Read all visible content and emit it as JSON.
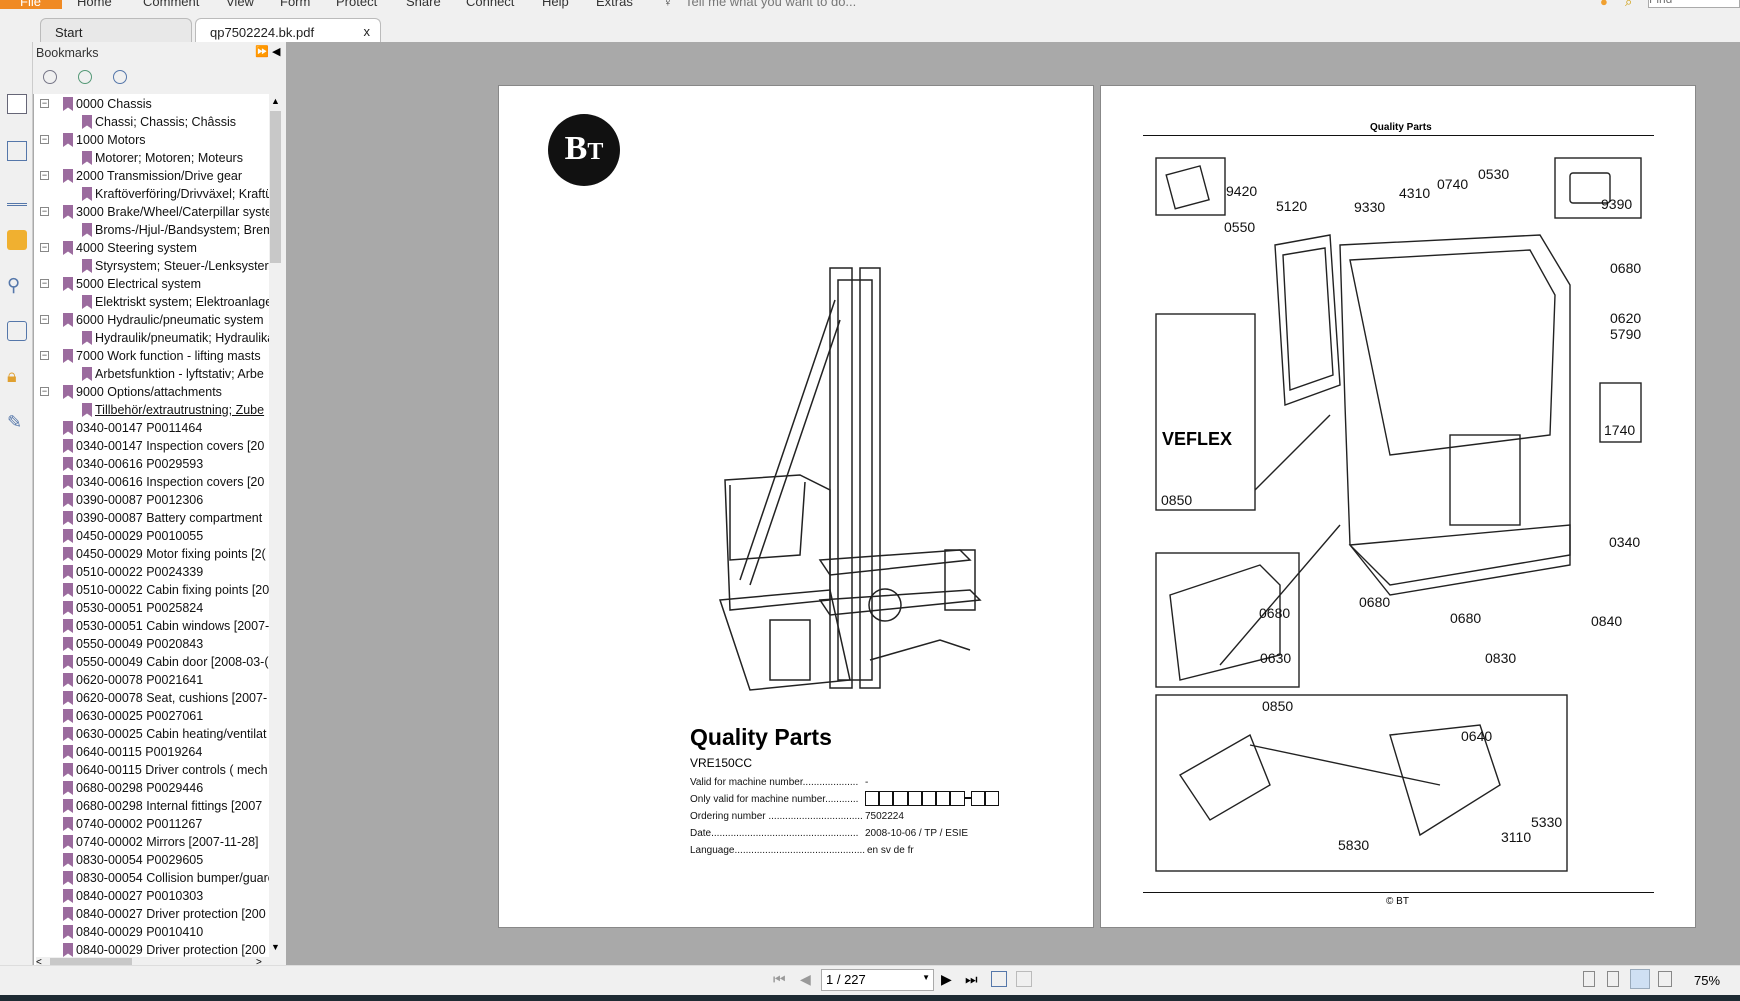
{
  "menu": {
    "file": "File",
    "items": [
      "Home",
      "Comment",
      "View",
      "Form",
      "Protect",
      "Share",
      "Connect",
      "Help",
      "Extras"
    ],
    "tell_me": "Tell me what you want to do...",
    "find_placeholder": "Find"
  },
  "tabs": [
    {
      "label": "Start"
    },
    {
      "label": "qp7502224.bk.pdf",
      "close": "x",
      "active": true
    }
  ],
  "bookmarks": {
    "title": "Bookmarks",
    "items": [
      {
        "level": 0,
        "expand": true,
        "label": "0000 Chassis"
      },
      {
        "level": 1,
        "label": "Chassi; Chassis; Châssis"
      },
      {
        "level": 0,
        "expand": true,
        "label": "1000 Motors"
      },
      {
        "level": 1,
        "label": "Motorer; Motoren; Moteurs"
      },
      {
        "level": 0,
        "expand": true,
        "label": "2000 Transmission/Drive gear"
      },
      {
        "level": 1,
        "label": "Kraftöverföring/Drivväxel; Kraftü"
      },
      {
        "level": 0,
        "expand": true,
        "label": "3000 Brake/Wheel/Caterpillar syste"
      },
      {
        "level": 1,
        "label": "Broms-/Hjul-/Bandsystem; Brem"
      },
      {
        "level": 0,
        "expand": true,
        "label": "4000 Steering system"
      },
      {
        "level": 1,
        "label": "Styrsystem; Steuer-/Lenksyster"
      },
      {
        "level": 0,
        "expand": true,
        "label": "5000 Electrical system"
      },
      {
        "level": 1,
        "label": "Elektriskt system; Elektroanlage"
      },
      {
        "level": 0,
        "expand": true,
        "label": "6000 Hydraulic/pneumatic system"
      },
      {
        "level": 1,
        "label": "Hydraulik/pneumatik; Hydraulika"
      },
      {
        "level": 0,
        "expand": true,
        "label": "7000 Work function - lifting masts"
      },
      {
        "level": 1,
        "label": "Arbetsfunktion - lyftstativ; Arbe"
      },
      {
        "level": 0,
        "expand": true,
        "label": "9000 Options/attachments"
      },
      {
        "level": 1,
        "label": "Tillbehör/extrautrustning; Zube",
        "selected": true
      },
      {
        "level": 0,
        "label": "0340-00147 P0011464"
      },
      {
        "level": 0,
        "label": "0340-00147 Inspection covers [20"
      },
      {
        "level": 0,
        "label": "0340-00616 P0029593"
      },
      {
        "level": 0,
        "label": "0340-00616 Inspection covers [20"
      },
      {
        "level": 0,
        "label": "0390-00087 P0012306"
      },
      {
        "level": 0,
        "label": "0390-00087 Battery compartment"
      },
      {
        "level": 0,
        "label": "0450-00029 P0010055"
      },
      {
        "level": 0,
        "label": "0450-00029 Motor fixing points [2("
      },
      {
        "level": 0,
        "label": "0510-00022 P0024339"
      },
      {
        "level": 0,
        "label": "0510-00022 Cabin fixing points [20"
      },
      {
        "level": 0,
        "label": "0530-00051 P0025824"
      },
      {
        "level": 0,
        "label": "0530-00051 Cabin windows [2007-"
      },
      {
        "level": 0,
        "label": "0550-00049 P0020843"
      },
      {
        "level": 0,
        "label": "0550-00049 Cabin door [2008-03-("
      },
      {
        "level": 0,
        "label": "0620-00078 P0021641"
      },
      {
        "level": 0,
        "label": "0620-00078 Seat, cushions [2007-"
      },
      {
        "level": 0,
        "label": "0630-00025 P0027061"
      },
      {
        "level": 0,
        "label": "0630-00025 Cabin heating/ventilat"
      },
      {
        "level": 0,
        "label": "0640-00115 P0019264"
      },
      {
        "level": 0,
        "label": "0640-00115 Driver controls ( mech"
      },
      {
        "level": 0,
        "label": "0680-00298 P0029446"
      },
      {
        "level": 0,
        "label": "0680-00298 Internal fittings [2007"
      },
      {
        "level": 0,
        "label": "0740-00002 P0011267"
      },
      {
        "level": 0,
        "label": "0740-00002 Mirrors [2007-11-28]"
      },
      {
        "level": 0,
        "label": "0830-00054 P0029605"
      },
      {
        "level": 0,
        "label": "0830-00054 Collision bumper/guarc"
      },
      {
        "level": 0,
        "label": "0840-00027 P0010303"
      },
      {
        "level": 0,
        "label": "0840-00027 Driver protection [200"
      },
      {
        "level": 0,
        "label": "0840-00029 P0010410"
      },
      {
        "level": 0,
        "label": "0840-00029 Driver protection [200"
      }
    ]
  },
  "page1": {
    "logo": "BT",
    "title": "Quality Parts",
    "model": "VRE150CC",
    "fields": [
      {
        "label": "Valid for machine number....................",
        "value": "-"
      },
      {
        "label": "Only valid for machine number............",
        "value": ""
      },
      {
        "label": "Ordering number ..................................",
        "value": "7502224"
      },
      {
        "label": "Date.....................................................",
        "value": "2008-10-06 / TP / ESIE"
      },
      {
        "label": "Language...............................................",
        "value": "en sv de fr"
      }
    ]
  },
  "page2": {
    "header": "Quality Parts",
    "footer": "© BT",
    "veflex": "VEFLEX",
    "part_labels": [
      "9420",
      "5120",
      "9330",
      "4310",
      "0740",
      "0530",
      "9390",
      "0550",
      "0680",
      "0620",
      "5790",
      "1740",
      "0850",
      "0340",
      "0680",
      "0630",
      "0680",
      "0680",
      "0840",
      "0830",
      "0850",
      "0640",
      "5330",
      "3110",
      "5830"
    ]
  },
  "status": {
    "page_indicator": "1 / 227",
    "zoom": "75%"
  },
  "colors": {
    "file_tab": "#f08a24",
    "bookmark_icon": "#9b6b9e",
    "doc_background": "#a9a9a9"
  }
}
